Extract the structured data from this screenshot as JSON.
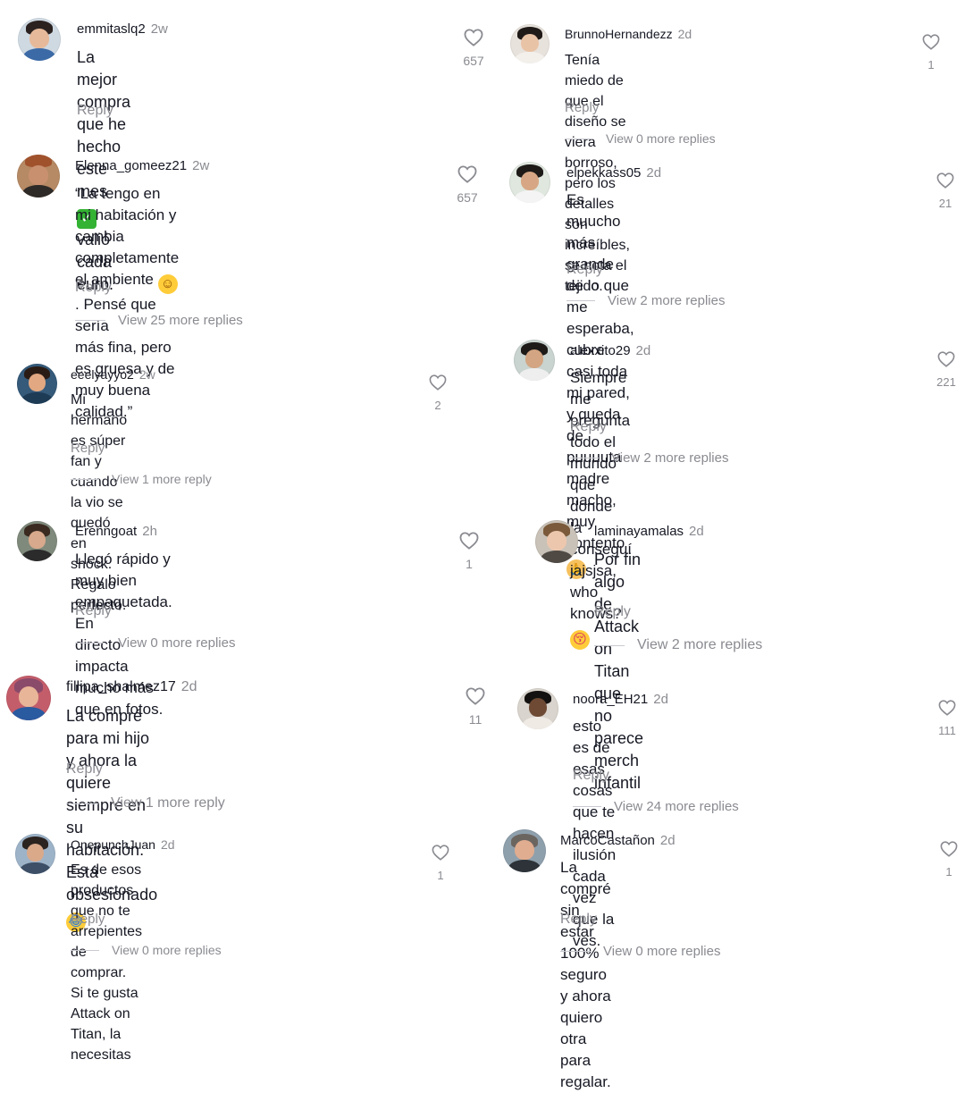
{
  "reply_label": "Reply",
  "comments_left": [
    {
      "user": "emmitaslq2",
      "time": "2w",
      "likes": "657",
      "lines": [
        "La mejor compra que he hecho este mes ",
        "valió cada euro."
      ],
      "emoji": "check",
      "view": ""
    },
    {
      "user": "Elenna_gomeez21",
      "time": "2w",
      "likes": "657",
      "lines": [
        "“La tengo en mi habitación y cambia",
        "completamente el ambiente ",
        ". Pensé que sería",
        "más fina, pero es gruesa y de muy buena",
        "calidad.”"
      ],
      "emoji": "smile",
      "view": "View 25 more replies"
    },
    {
      "user": "eeelyayyo2",
      "time": "2w",
      "likes": "2",
      "lines": [
        "Mi hermano es súper fan y cuando la vio se",
        "quedó en shock. Regalo perfecto."
      ],
      "view": "View 1 more reply"
    },
    {
      "user": "Erenngoat",
      "time": "2h",
      "likes": "1",
      "lines": [
        "Llegó rápido y muy bien empaquetada. En",
        "directo impacta mucho más que en fotos."
      ],
      "view": "View 0 more replies"
    },
    {
      "user": "fillipa_shalmez17",
      "time": "2d",
      "likes": "11",
      "lines": [
        "La compré para mi hijo y ahora la quiere",
        "siempre en su habitación. Está obsesionado "
      ],
      "emoji": "laugh",
      "view": "View 1 more reply"
    },
    {
      "user": "OnepunchJuan",
      "time": "2d",
      "likes": "1",
      "lines": [
        "Es de esos productos que no te arrepientes de",
        "comprar. Si te gusta Attack on Titan, la necesitas"
      ],
      "view": "View 0 more replies"
    }
  ],
  "comments_right": [
    {
      "user": "BrunnoHernandezz",
      "time": "2d",
      "likes": "1",
      "lines": [
        "Tenía miedo de que el diseño se viera borroso,",
        "pero los detalles son increíbles, se nota el tejido."
      ],
      "view": "View 0 more replies"
    },
    {
      "user": "elpekkass05",
      "time": "2d",
      "likes": "21",
      "lines": [
        "Es muucho más grande de lo que me esperaba,",
        "cubre casi toda mi pared, y queda de puuuuta",
        "madre macho, muy contento"
      ],
      "emoji": "pray",
      "view": "View 2 more replies"
    },
    {
      "user": "alexxito29",
      "time": "2d",
      "likes": "221",
      "lines": [
        "Siempre me pregunta todo el mundo que donde",
        "la conseguí jajsjsa, who knows? "
      ],
      "emoji": "kiss",
      "view": "View 2 more replies"
    },
    {
      "user": "laminayamalas",
      "time": "2d",
      "likes": "",
      "lines": [
        "Por fin algo de Attack on Titan que no parece",
        "merch infantil"
      ],
      "view": "View 2 more replies"
    },
    {
      "user": "noora_EH21",
      "time": "2d",
      "likes": "111",
      "lines": [
        "esto es de esas cosas que te hacen ilusión cada",
        "vez que la ves."
      ],
      "view": "View 24 more replies"
    },
    {
      "user": "MarcoCastañon",
      "time": "2d",
      "likes": "1",
      "lines": [
        "La compré sin estar 100% seguro y ahora quiero",
        "otra para regalar."
      ],
      "view": "View 0 more replies"
    }
  ],
  "colors": {
    "text": "#161823",
    "muted": "#8a8b91",
    "heart": "#8a8b91",
    "line": "#c9cad0"
  },
  "icons": {
    "like": "heart-outline-icon"
  }
}
